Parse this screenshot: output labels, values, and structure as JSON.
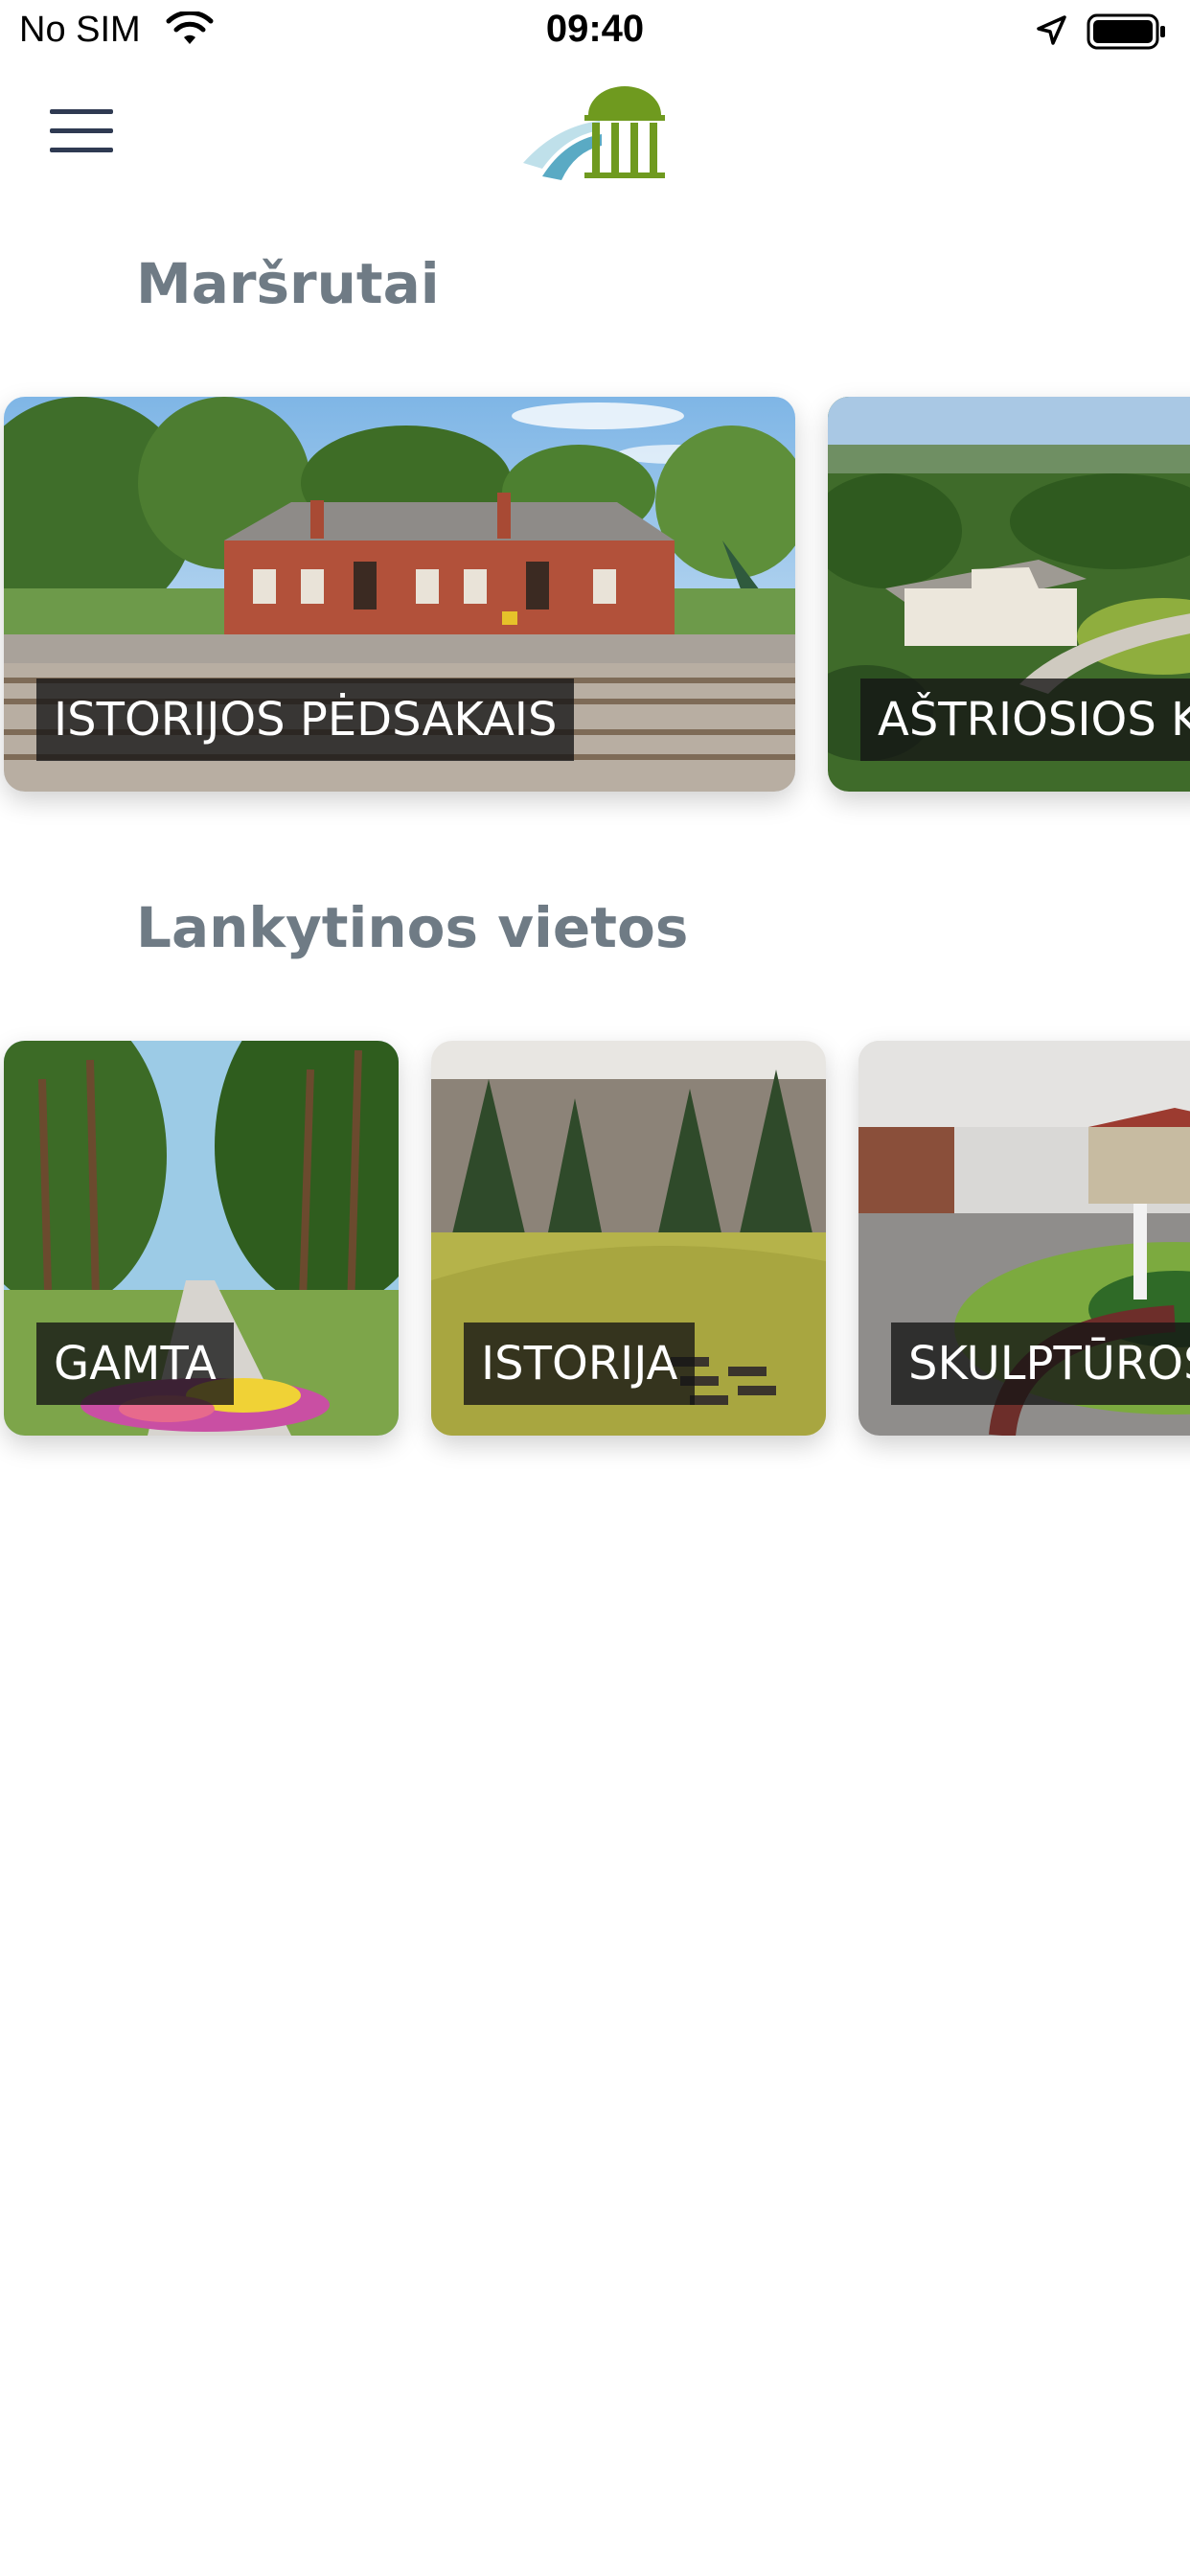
{
  "status_bar": {
    "carrier": "No SIM",
    "time": "09:40"
  },
  "header": {
    "menu_icon": "hamburger-menu-icon",
    "logo_icon": "rotunda-logo-icon"
  },
  "routes": {
    "title": "Maršrutai",
    "cards": [
      {
        "label": "ISTORIJOS PĖDSAKAIS"
      },
      {
        "label": "AŠTRIOSIOS K"
      }
    ]
  },
  "places": {
    "title": "Lankytinos vietos",
    "cards": [
      {
        "label": "GAMTA"
      },
      {
        "label": "ISTORIJA"
      },
      {
        "label": "SKULPTŪROS"
      }
    ]
  },
  "colors": {
    "heading": "#6f7b85",
    "menu": "#2f3a52",
    "logo_green": "#6f9a1f",
    "logo_blue": "#5aaac4"
  }
}
